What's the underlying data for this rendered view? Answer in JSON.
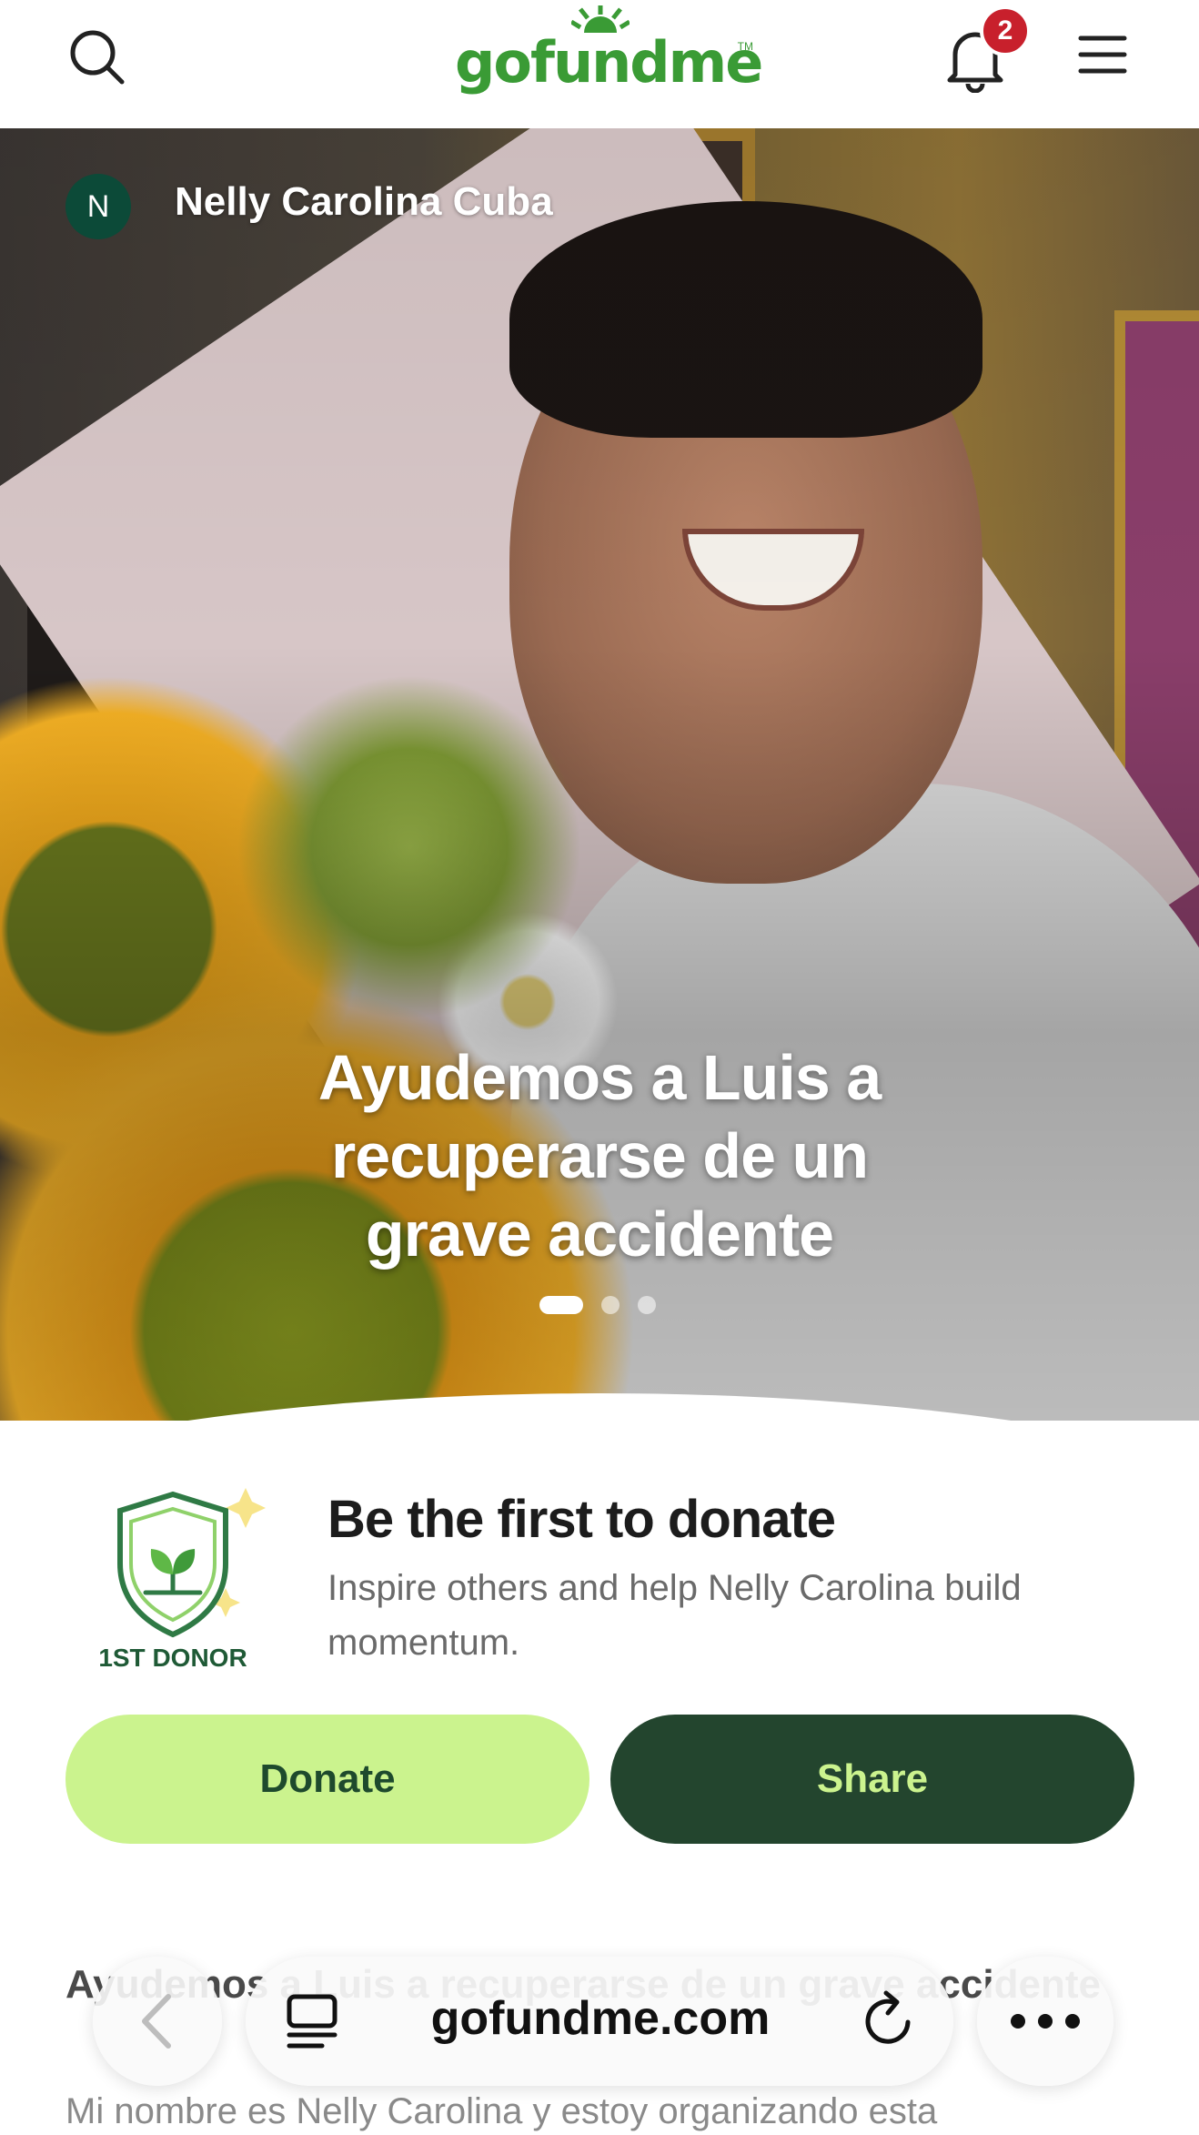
{
  "header": {
    "logo_text": "gofundme",
    "logo_tm": "TM",
    "notification_count": "2",
    "icons": {
      "search": "search-icon",
      "bell": "bell-icon",
      "menu": "hamburger-menu-icon"
    },
    "brand_color": "#3a9b35"
  },
  "hero": {
    "organizer_initial": "N",
    "organizer_name": "Nelly Carolina Cuba",
    "title": "Ayudemos a Luis a recuperarse de un grave accidente",
    "carousel": {
      "slides": 3,
      "active": 1
    }
  },
  "first_donor": {
    "badge_label": "1ST DONOR",
    "title": "Be the first to donate",
    "subtitle": "Inspire others and help Nelly Carolina build momentum."
  },
  "actions": {
    "donate_label": "Donate",
    "share_label": "Share",
    "colors": {
      "donate_bg": "#cbf38e",
      "share_bg": "#23452e"
    }
  },
  "story": {
    "title": "Ayudemos a Luis a recuperarse de un grave accidente",
    "body": "Mi nombre es Nelly Carolina y estoy organizando esta"
  },
  "browser": {
    "url": "gofundme.com",
    "icons": {
      "back": "chevron-left-icon",
      "tabs": "tabs-icon",
      "reload": "reload-icon",
      "more": "more-icon"
    }
  }
}
